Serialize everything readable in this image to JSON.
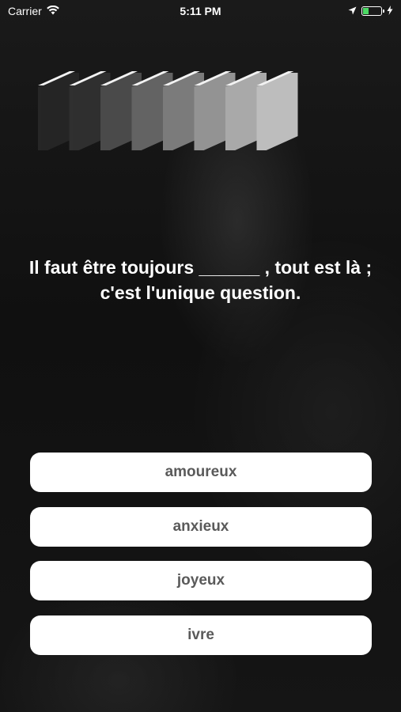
{
  "status_bar": {
    "carrier": "Carrier",
    "time": "5:11 PM",
    "battery_color": "#4cd964"
  },
  "icons": {
    "wifi": "wifi-icon",
    "location": "location-arrow-icon",
    "battery": "battery-icon",
    "charging": "charging-bolt-icon",
    "progress": "books-progress-icon"
  },
  "quiz": {
    "question": "Il faut être toujours ______ , tout est là ; c'est l'unique question.",
    "answers": [
      {
        "label": "amoureux"
      },
      {
        "label": "anxieux"
      },
      {
        "label": "joyeux"
      },
      {
        "label": "ivre"
      }
    ]
  },
  "colors": {
    "background": "#141414",
    "button": "#ffffff",
    "button_text": "#5a5a5a"
  }
}
